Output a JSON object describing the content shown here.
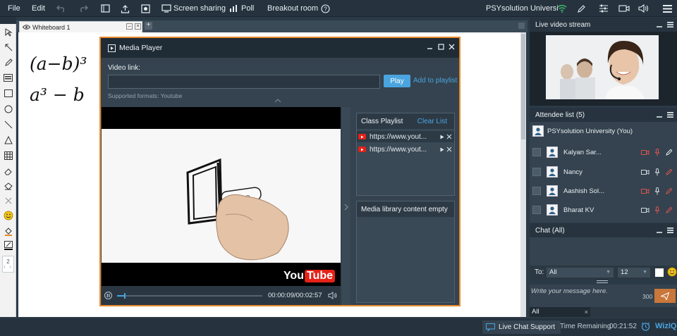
{
  "topbar": {
    "file": "File",
    "edit": "Edit",
    "screen_sharing": "Screen sharing",
    "poll": "Poll",
    "breakout_room": "Breakout room",
    "org_name": "PSYsolution Universi"
  },
  "whiteboard": {
    "tab_label": "Whiteboard 1",
    "line1": "(a−b)³",
    "line2": "a³ − b",
    "tool_page_number": "2"
  },
  "media_player": {
    "title": "Media Player",
    "video_link_label": "Video link:",
    "video_link_value": "",
    "play_label": "Play",
    "add_to_playlist": "Add to playlist",
    "supported_formats": "Supported formats: Youtube",
    "time": "00:00:09/00:02:57",
    "progress": 0.05,
    "youtube_logo": "YouTube",
    "playlist": {
      "title": "Class Playlist",
      "clear": "Clear List",
      "items": [
        {
          "url": "https://www.yout..."
        },
        {
          "url": "https://www.yout..."
        }
      ]
    },
    "library": {
      "title": "Media library content empty"
    }
  },
  "live_stream": {
    "title": "Live video stream"
  },
  "attendees": {
    "title": "Attendee list (5)",
    "host": "PSYsolution University (You)",
    "list": [
      {
        "name": "Kalyan Sar..."
      },
      {
        "name": "Nancy"
      },
      {
        "name": "Aashish Sol..."
      },
      {
        "name": "Bharat KV"
      }
    ]
  },
  "chat": {
    "title": "Chat (All)",
    "to_label": "To:",
    "to_value": "All",
    "font_size": "12",
    "placeholder": "Write your message here.",
    "char_count": "300",
    "tab_all": "All"
  },
  "bottombar": {
    "live_chat_support": "Live Chat Support",
    "time_remaining_label": "Time Remaining",
    "time_remaining_value": "00:21:52",
    "brand": "WizIQ"
  },
  "colors": {
    "accent": "#e8892b",
    "play_button": "#4aa4df",
    "youtube_red": "#e62117",
    "link": "#4aa4df"
  }
}
